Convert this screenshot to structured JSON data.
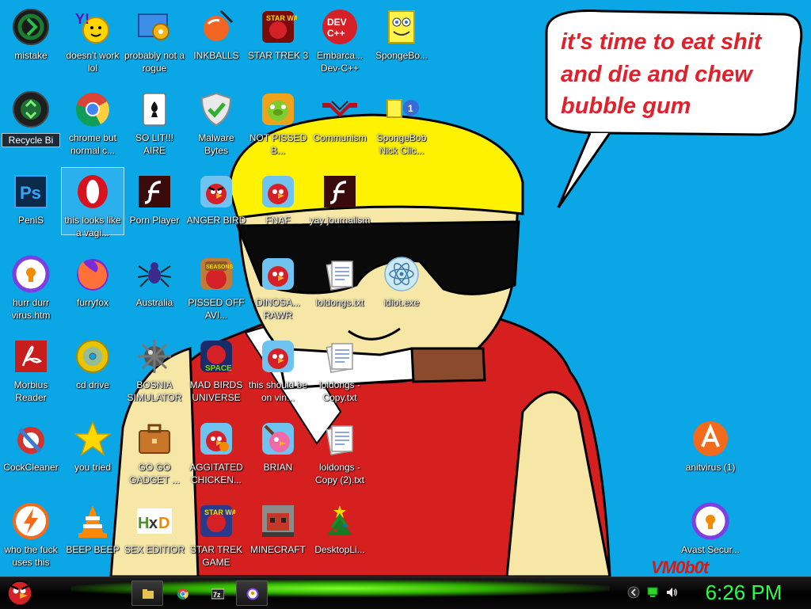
{
  "bubble": {
    "lines": [
      "it's time to eat shit",
      "and die and chew",
      "bubble gum"
    ]
  },
  "watermark": "VM0b0t",
  "icons": [
    {
      "label": "mistake",
      "icon": "green-orb-icon"
    },
    {
      "label": "doesn't work lol",
      "icon": "yahoo-messenger-icon"
    },
    {
      "label": "probably not a rogue",
      "icon": "control-panel-icon"
    },
    {
      "label": "INKBALLS",
      "icon": "inkball-icon"
    },
    {
      "label": "STAR TREK 3",
      "icon": "star-wars-game-icon"
    },
    {
      "label": "Embarca... Dev-C++",
      "icon": "devcpp-icon"
    },
    {
      "label": "SpongeBo...",
      "icon": "spongebob-icon"
    },
    {
      "label": "Recycle Bi",
      "icon": "recycle-bin-icon"
    },
    {
      "label": "chrome but normal c...",
      "icon": "chrome-icon"
    },
    {
      "label": "SO LIT!!! AIRE",
      "icon": "solitaire-icon"
    },
    {
      "label": "Malware Bytes",
      "icon": "shield-check-icon"
    },
    {
      "label": "NOT PISSED B...",
      "icon": "bad-piggies-icon"
    },
    {
      "label": "Communism",
      "icon": "communism-icon"
    },
    {
      "label": "SpongeBob Nick Clic...",
      "icon": "spongebob-small-icon"
    },
    {
      "label": "PeniS",
      "icon": "photoshop-icon"
    },
    {
      "label": "this looks like a vagi...",
      "icon": "opera-icon"
    },
    {
      "label": "Porn Player",
      "icon": "flash-player-icon"
    },
    {
      "label": "ANGER BIRD",
      "icon": "angry-birds-icon"
    },
    {
      "label": "FNAF",
      "icon": "angry-birds-icon"
    },
    {
      "label": "yay journalism",
      "icon": "flash-player-icon"
    },
    {
      "label": "hurr durr virus.htm",
      "icon": "avast-browser-icon"
    },
    {
      "label": "furryfox",
      "icon": "firefox-icon"
    },
    {
      "label": "Australia",
      "icon": "spider-solitaire-icon"
    },
    {
      "label": "PISSED OFF AVI...",
      "icon": "angry-birds-seasons-icon"
    },
    {
      "label": "DINOSA... RAWR",
      "icon": "angry-birds-icon"
    },
    {
      "label": "loldongs.txt",
      "icon": "text-file-icon"
    },
    {
      "label": "idiot.exe",
      "icon": "electron-icon"
    },
    {
      "label": "Morbius Reader",
      "icon": "acrobat-reader-icon"
    },
    {
      "label": "cd drive",
      "icon": "cd-icon"
    },
    {
      "label": "BOSNIA SIMULATOR",
      "icon": "mine-icon"
    },
    {
      "label": "MAD BIRDS UNIVERSE",
      "icon": "angry-birds-space-icon"
    },
    {
      "label": "this should be on vin...",
      "icon": "angry-birds-icon"
    },
    {
      "label": "loldongs - Copy.txt",
      "icon": "text-file-icon"
    },
    {
      "label": "CockCleaner",
      "icon": "ccleaner-icon"
    },
    {
      "label": "you tried",
      "icon": "star-icon"
    },
    {
      "label": "GO GO GADGET ...",
      "icon": "briefcase-icon"
    },
    {
      "label": "AGGITATED CHICKEN...",
      "icon": "angry-birds-icon"
    },
    {
      "label": "BRIAN",
      "icon": "angry-birds-pink-icon"
    },
    {
      "label": "loldongs - Copy (2).txt",
      "icon": "text-file-icon"
    },
    {
      "label": "anitvirus (1)",
      "icon": "avast-icon"
    },
    {
      "label": "who the fuck uses this",
      "icon": "flash-bolt-icon"
    },
    {
      "label": "BEEP BEEP",
      "icon": "vlc-icon"
    },
    {
      "label": "SEX EDITIOR",
      "icon": "hxd-icon"
    },
    {
      "label": "STAR TREK GAME",
      "icon": "star-wars-game-icon"
    },
    {
      "label": "MINECRAFT",
      "icon": "minecraft-icon"
    },
    {
      "label": "DesktopLi...",
      "icon": "christmas-tree-icon"
    },
    {
      "label": "Avast Secur...",
      "icon": "avast-browser-icon"
    }
  ],
  "taskbar": {
    "start_icon": "angry-bird-start-icon",
    "pinned": [
      "file-explorer-icon",
      "chrome-icon",
      "7zip-icon",
      "avast-browser-icon"
    ],
    "tray": [
      "chevron-left-icon",
      "network-icon",
      "volume-icon"
    ],
    "clock": "6:26 PM"
  }
}
